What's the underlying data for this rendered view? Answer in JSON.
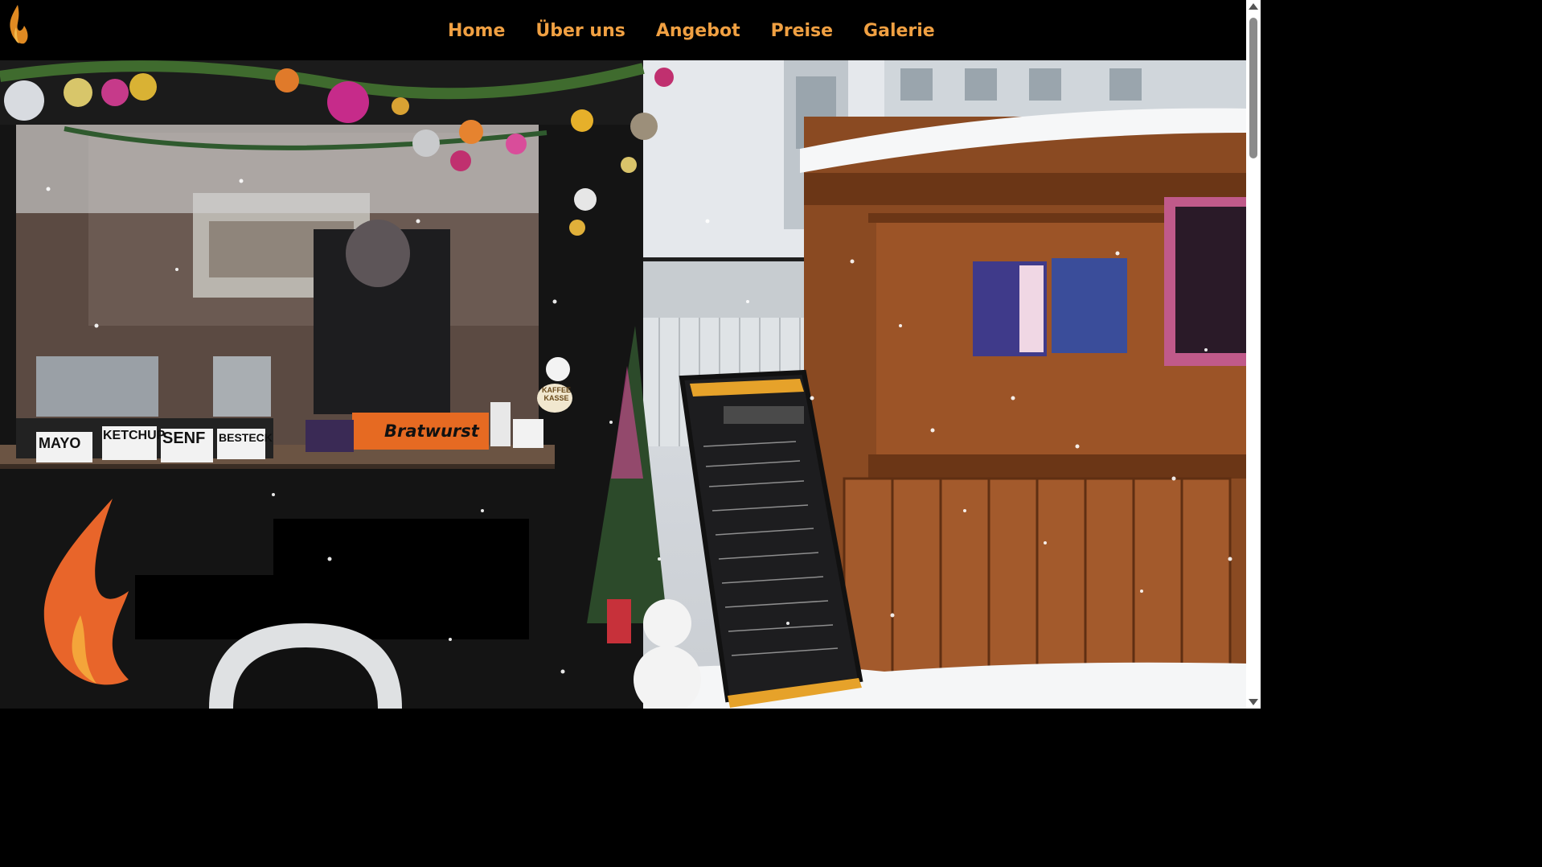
{
  "header": {
    "logo_icon": "flame-icon",
    "nav": [
      {
        "label": "Home"
      },
      {
        "label": "Über uns"
      },
      {
        "label": "Angebot"
      },
      {
        "label": "Preise"
      },
      {
        "label": "Galerie"
      }
    ],
    "nav_color": "#f0a042",
    "background": "#000000"
  },
  "hero": {
    "icon": "food-truck-photo",
    "truck_labels": {
      "bratwurst": "Bratwurst",
      "mayo": "MAYO",
      "ketchup": "KETCHUP",
      "senf": "SENF",
      "besteck": "BESTECK",
      "kaffee": "KAFFEE KASSE"
    }
  }
}
